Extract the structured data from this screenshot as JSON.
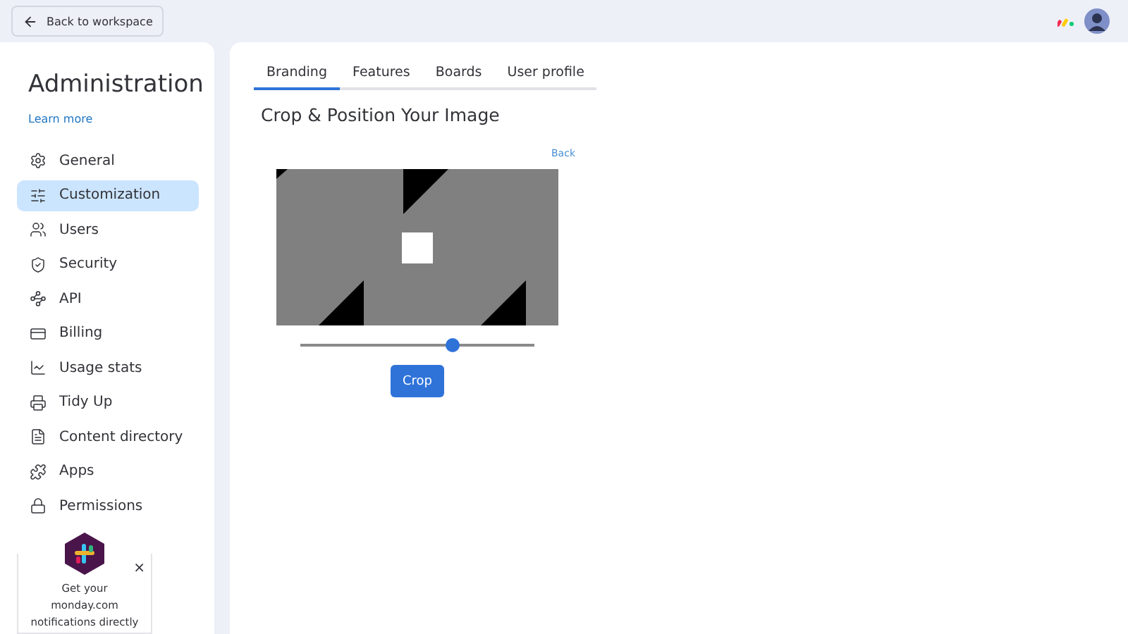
{
  "top_bar": {
    "back_button": "Back to workspace"
  },
  "sidebar": {
    "title": "Administration",
    "link": "Learn more",
    "items": [
      {
        "label": "General",
        "selected": false
      },
      {
        "label": "Customization",
        "selected": true
      },
      {
        "label": "Users",
        "selected": false
      },
      {
        "label": "Security",
        "selected": false
      },
      {
        "label": "API",
        "selected": false
      },
      {
        "label": "Billing",
        "selected": false
      },
      {
        "label": "Usage stats",
        "selected": false
      },
      {
        "label": "Tidy Up",
        "selected": false
      },
      {
        "label": "Content directory",
        "selected": false
      },
      {
        "label": "Apps",
        "selected": false
      },
      {
        "label": "Permissions",
        "selected": false
      }
    ],
    "promo": {
      "text": "Get your monday.com notifications directly",
      "close": "×"
    }
  },
  "tabs": [
    {
      "label": "Branding",
      "selected": true
    },
    {
      "label": "Features",
      "selected": false
    },
    {
      "label": "Boards",
      "selected": false
    },
    {
      "label": "User profile",
      "selected": false
    }
  ],
  "cropper": {
    "title": "Crop & Position Your Image",
    "back_link": "Back",
    "zoom": {
      "level": 0.65
    },
    "button": "Crop"
  }
}
